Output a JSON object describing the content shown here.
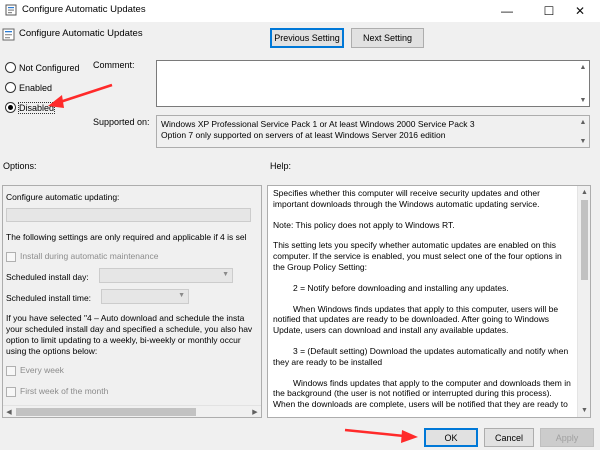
{
  "window": {
    "title": "Configure Automatic Updates",
    "min_glyph": "—",
    "max_glyph": "☐",
    "close_glyph": "✕"
  },
  "header": {
    "policy_name": "Configure Automatic Updates",
    "prev_button": "Previous Setting",
    "next_button": "Next Setting"
  },
  "state": {
    "options": [
      {
        "label": "Not Configured",
        "selected": false
      },
      {
        "label": "Enabled",
        "selected": false
      },
      {
        "label": "Disabled",
        "selected": true
      }
    ]
  },
  "comment": {
    "label": "Comment:",
    "value": ""
  },
  "supported": {
    "label": "Supported on:",
    "lines": [
      "Windows XP Professional Service Pack 1 or At least Windows 2000 Service Pack 3",
      "Option 7 only supported on servers of at least Windows Server 2016 edition"
    ]
  },
  "options_panel": {
    "label": "Options:",
    "configure_label": "Configure automatic updating:",
    "note": "The following settings are only required and applicable if 4 is sel",
    "install_maintenance": "Install during automatic maintenance",
    "scheduled_day_label": "Scheduled install day:",
    "scheduled_time_label": "Scheduled install time:",
    "para": [
      "If you have selected \"4 – Auto download and schedule the insta",
      "your scheduled install day and specified a schedule, you also hav",
      "option to limit updating to a weekly, bi-weekly or monthly occur",
      "using the options below:"
    ],
    "every_week": "Every week",
    "first_week": "First week of the month"
  },
  "help_panel": {
    "label": "Help:",
    "paragraphs": [
      "Specifies whether this computer will receive security updates and other important downloads through the Windows automatic updating service.",
      "Note: This policy does not apply to Windows RT.",
      "This setting lets you specify whether automatic updates are enabled on this computer. If the service is enabled, you must select one of the four options in the Group Policy Setting:",
      "2 = Notify before downloading and installing any updates.",
      "When Windows finds updates that apply to this computer, users will be notified that updates are ready to be downloaded. After going to Windows Update, users can download and install any available updates.",
      "3 = (Default setting) Download the updates automatically and notify when they are ready to be installed",
      "Windows finds updates that apply to the computer and downloads them in the background (the user is not notified or interrupted during this process). When the downloads are complete, users will be notified that they are ready to"
    ]
  },
  "footer": {
    "ok": "OK",
    "cancel": "Cancel",
    "apply": "Apply"
  },
  "colors": {
    "annotation_arrow": "#ff2a2a",
    "focus_border": "#0078d7"
  }
}
